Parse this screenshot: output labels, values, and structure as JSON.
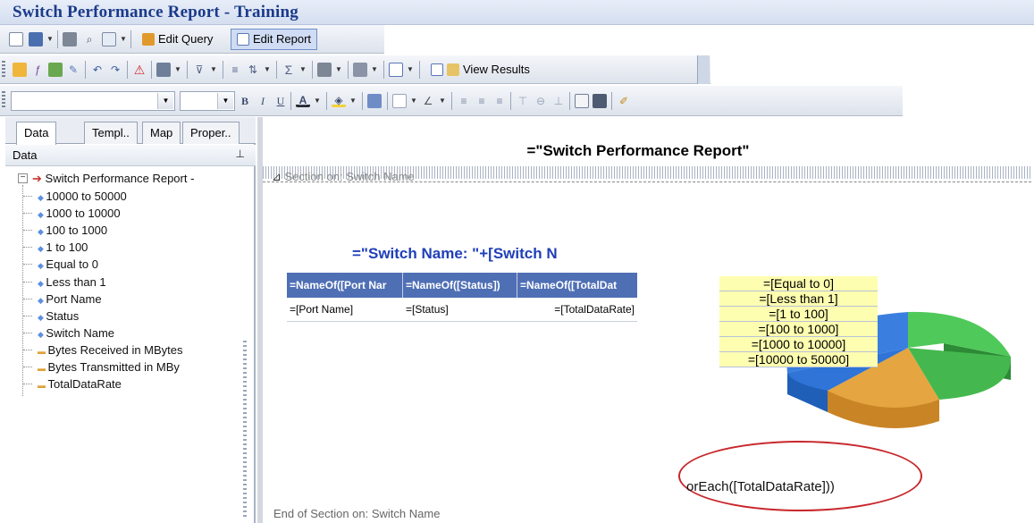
{
  "window": {
    "title": "Switch Performance Report - Training"
  },
  "toolbar1": {
    "edit_query_label": "Edit Query",
    "edit_report_label": "Edit Report"
  },
  "toolbar2": {
    "view_results_label": "View Results"
  },
  "left_panel": {
    "tabs": [
      "Data",
      "Templ..",
      "Map",
      "Proper.."
    ],
    "panel_title": "Data",
    "tree": {
      "root": "Switch Performance Report -",
      "items": [
        {
          "label": "10000 to 50000",
          "kind": "dimension"
        },
        {
          "label": "1000 to 10000",
          "kind": "dimension"
        },
        {
          "label": "100 to 1000",
          "kind": "dimension"
        },
        {
          "label": "1 to 100",
          "kind": "dimension"
        },
        {
          "label": "Equal to 0",
          "kind": "dimension"
        },
        {
          "label": "Less than 1",
          "kind": "dimension"
        },
        {
          "label": "Port Name",
          "kind": "dimension"
        },
        {
          "label": "Status",
          "kind": "dimension"
        },
        {
          "label": "Switch Name",
          "kind": "dimension"
        },
        {
          "label": "Bytes Received in MBytes",
          "kind": "measure"
        },
        {
          "label": "Bytes Transmitted in MBy",
          "kind": "measure"
        },
        {
          "label": "TotalDataRate",
          "kind": "measure"
        }
      ]
    }
  },
  "report": {
    "title_formula": "=\"Switch Performance Report\"",
    "section_label": "Section on: Switch Name",
    "switch_name_formula": "=\"Switch Name: \"+[Switch N",
    "table": {
      "headers": [
        "=NameOf([Port Nar",
        "=NameOf([Status])",
        "=NameOf([TotalDat"
      ],
      "row": [
        "=[Port Name]",
        "=[Status]",
        "=[TotalDataRate]"
      ]
    },
    "chart_legend": [
      "=[Equal to 0]",
      "=[Less than 1]",
      "=[1 to 100]",
      "=[100 to 1000]",
      "=[1000 to 10000]",
      "=[10000 to 50000]"
    ],
    "foreach_formula": "orEach([TotalDataRate]))",
    "end_section_label": "End of Section on: Switch Name"
  },
  "colors": {
    "title_text": "#1a3a8a",
    "table_header": "#4f6fb5",
    "legend_bg": "#fefeb0",
    "highlight_oval": "#c8262b",
    "pie_green": "#3fb34a",
    "pie_orange": "#e5a540",
    "pie_blue": "#3a7fe0"
  }
}
